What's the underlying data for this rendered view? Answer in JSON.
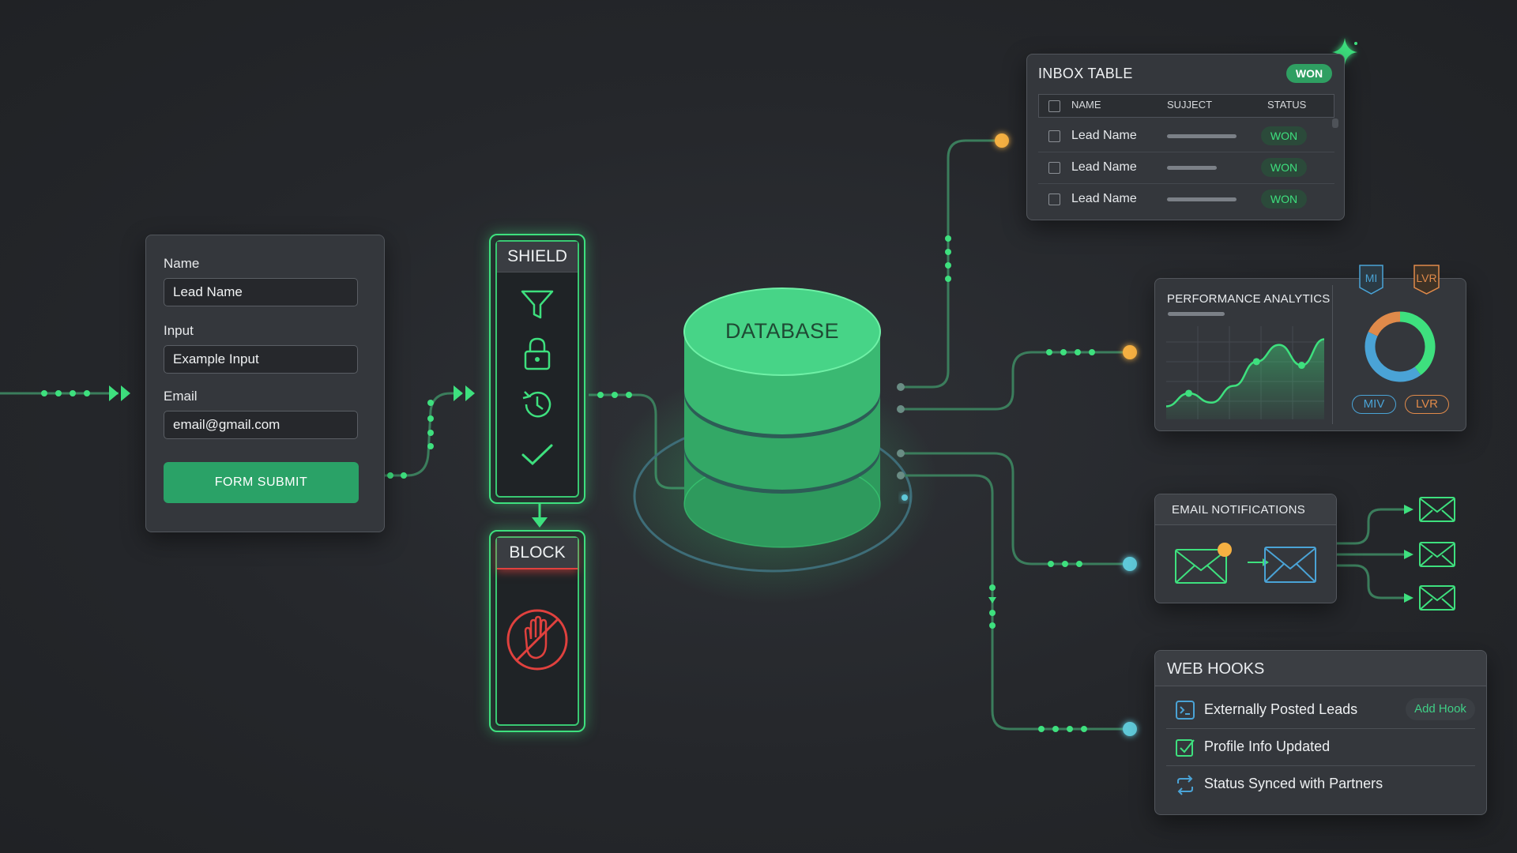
{
  "colors": {
    "accent_green": "#3ee07e",
    "button_green": "#2aa267",
    "amber_node": "#f5b042",
    "cyan_node": "#5ec8d8",
    "block_red": "#e0413e",
    "chart_blue": "#4aa3d6",
    "chart_orange": "#e08a4a"
  },
  "form": {
    "name_label": "Name",
    "name_value": "Lead Name",
    "input_label": "Input",
    "input_value": "Example Input",
    "email_label": "Email",
    "email_value": "email@gmail.com",
    "submit_label": "FORM SUBMIT"
  },
  "shield": {
    "title": "SHIELD",
    "icons": [
      "filter-icon",
      "lock-icon",
      "history-icon",
      "check-icon"
    ]
  },
  "block": {
    "title": "BLOCK",
    "icon": "stop-hand-icon"
  },
  "database": {
    "label": "DATABASE"
  },
  "inbox": {
    "title": "INBOX TABLE",
    "badge": "WON",
    "columns": [
      "NAME",
      "SUJJECT",
      "STATUS"
    ],
    "rows": [
      {
        "name": "Lead Name",
        "status": "WON",
        "subject_fill": 1.0
      },
      {
        "name": "Lead Name",
        "status": "WON",
        "subject_fill": 0.72
      },
      {
        "name": "Lead Name",
        "status": "WON",
        "subject_fill": 1.0
      }
    ]
  },
  "analytics": {
    "title": "PERFORMANCE ANALYTICS",
    "tag_left": "MI",
    "tag_right": "LVR",
    "pill_left": "MIV",
    "pill_right": "LVR",
    "trend": [
      0.14,
      0.28,
      0.18,
      0.36,
      0.62,
      0.8,
      0.58,
      0.86
    ],
    "donut": [
      {
        "color": "#3ee07e",
        "share": 0.4
      },
      {
        "color": "#4aa3d6",
        "share": 0.42
      },
      {
        "color": "#e08a4a",
        "share": 0.18
      }
    ]
  },
  "email": {
    "title": "EMAIL NOTIFICATIONS",
    "icons": [
      "envelope-icon",
      "arrow-right-icon",
      "envelope-icon"
    ]
  },
  "webhooks": {
    "title": "WEB HOOKS",
    "add_label": "Add Hook",
    "items": [
      {
        "label": "Externally Posted Leads",
        "icon": "terminal-icon"
      },
      {
        "label": "Profile Info Updated",
        "icon": "checkbox-icon"
      },
      {
        "label": "Status Synced with Partners",
        "icon": "sync-icon"
      }
    ]
  }
}
